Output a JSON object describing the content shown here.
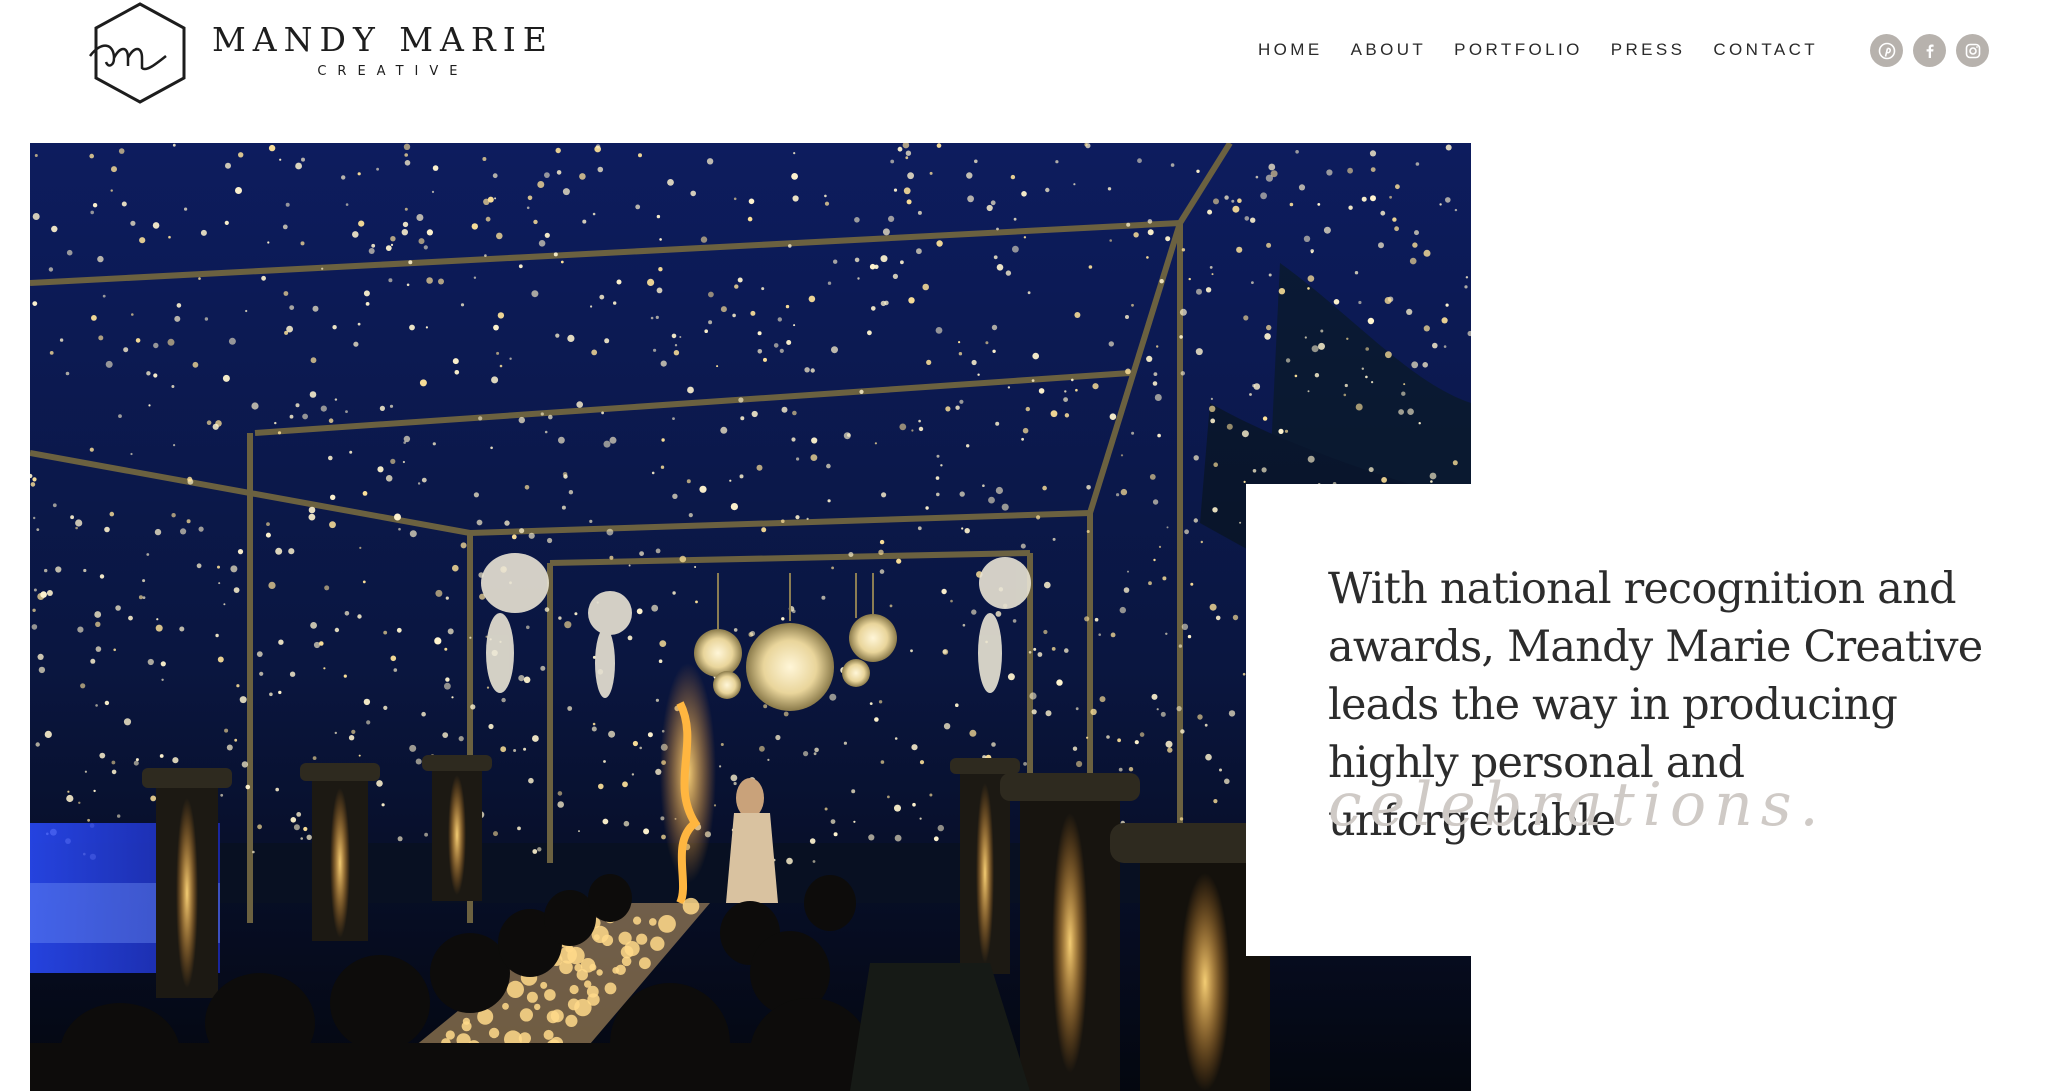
{
  "brand": {
    "name": "MANDY MARIE",
    "sub": "CREATIVE"
  },
  "nav": {
    "items": [
      "HOME",
      "ABOUT",
      "PORTFOLIO",
      "PRESS",
      "CONTACT"
    ]
  },
  "social": {
    "icons": [
      "pinterest-icon",
      "facebook-icon",
      "instagram-icon"
    ],
    "color": "#b7b2ad"
  },
  "hero": {
    "statement": "With national recognition and awards, Mandy Marie Creative leads the way in producing highly personal and unforgettable",
    "script_word": "celebrations."
  },
  "colors": {
    "text": "#2c2c2c",
    "script": "#cfcac6",
    "night_sky": "#0c1533",
    "light_glow": "#ffe9b0"
  }
}
